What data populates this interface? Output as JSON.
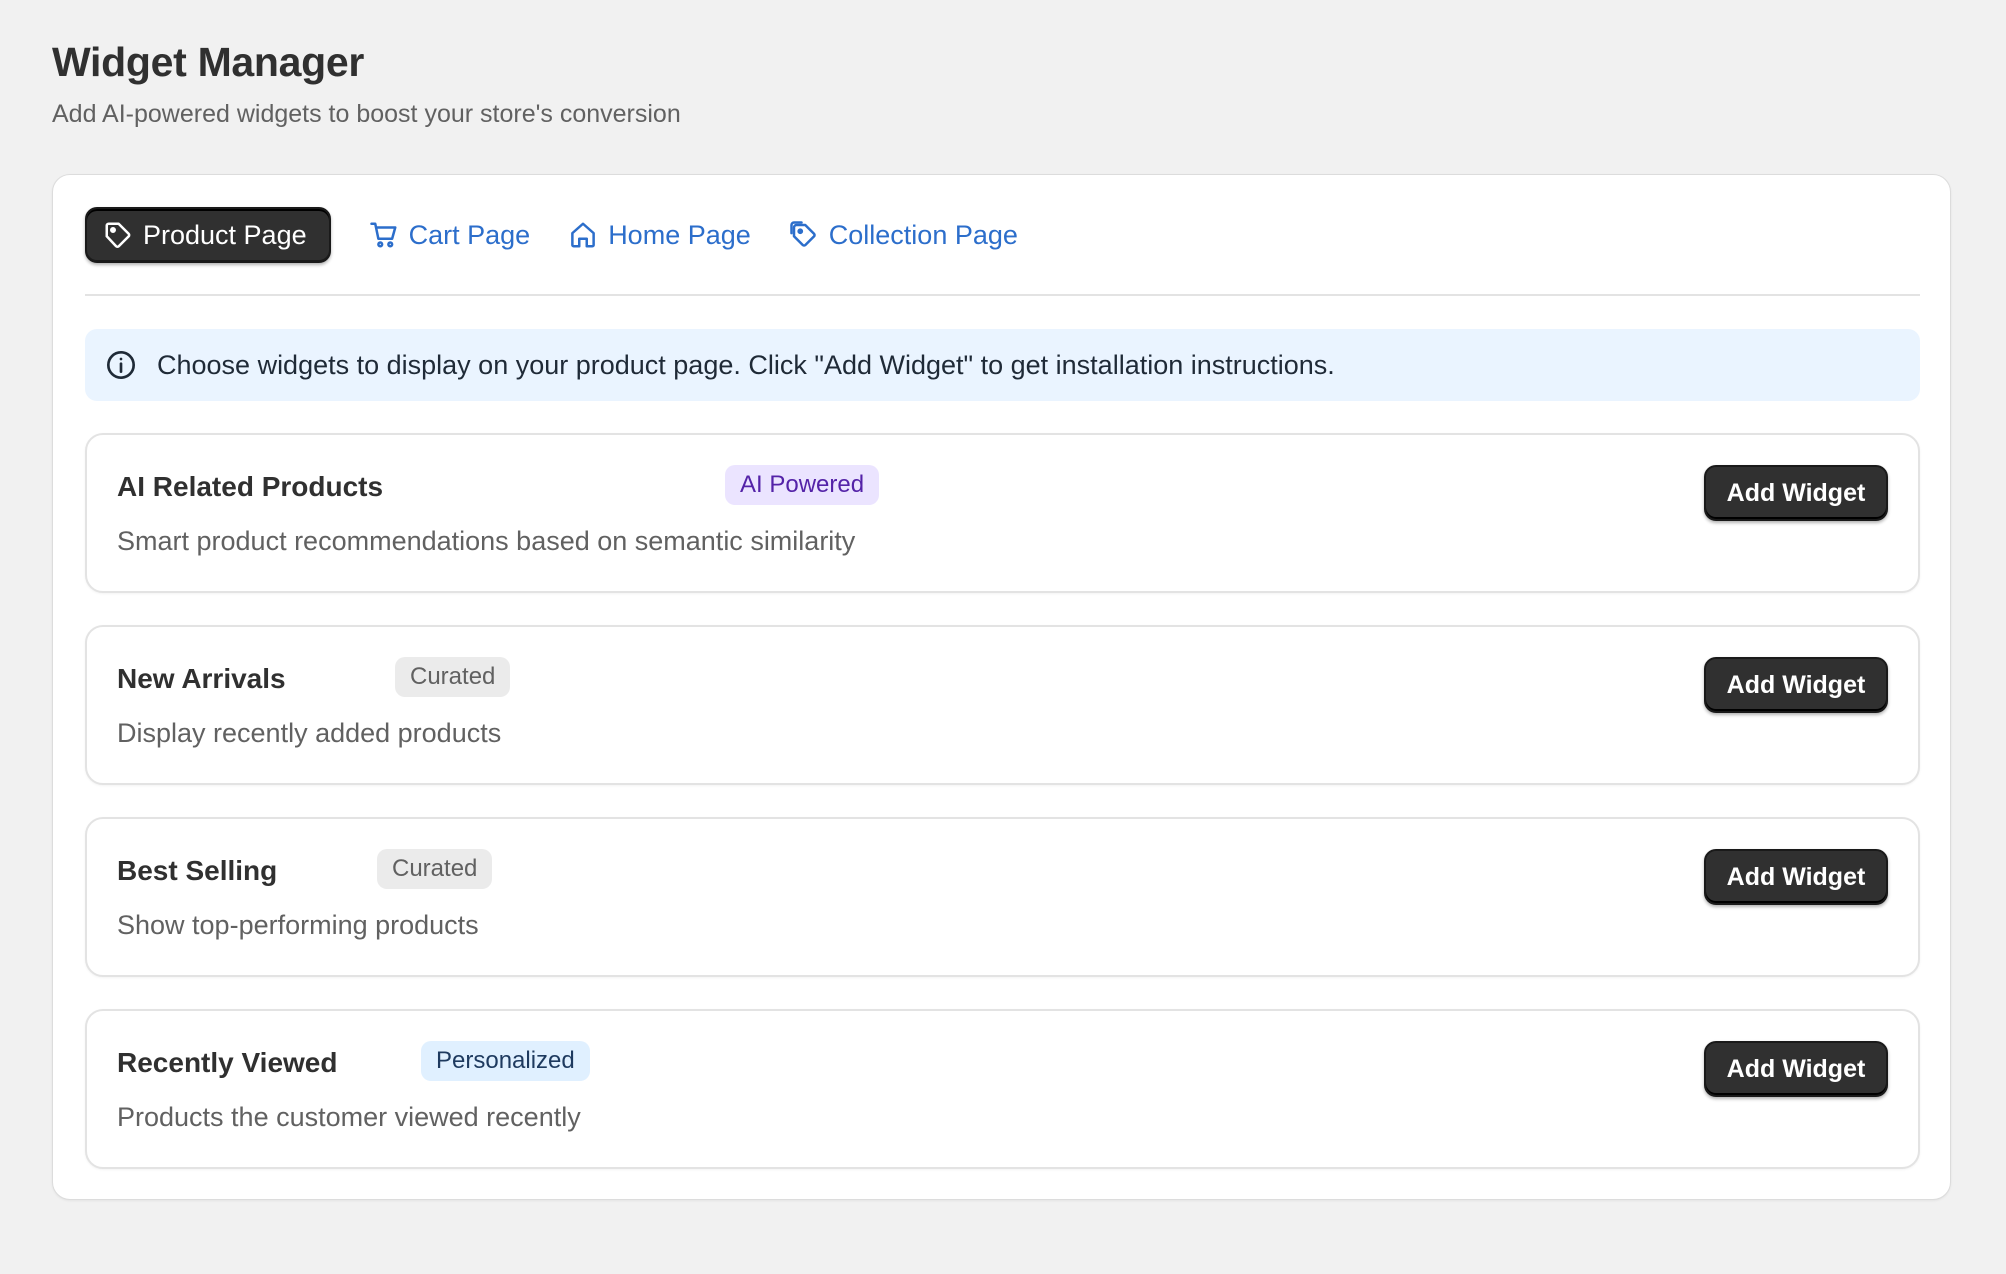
{
  "header": {
    "title": "Widget Manager",
    "subtitle": "Add AI-powered widgets to boost your store's conversion"
  },
  "tabs": [
    {
      "label": "Product Page",
      "icon": "tag-icon",
      "active": true
    },
    {
      "label": "Cart Page",
      "icon": "cart-icon",
      "active": false
    },
    {
      "label": "Home Page",
      "icon": "home-icon",
      "active": false
    },
    {
      "label": "Collection Page",
      "icon": "collection-tag-icon",
      "active": false
    }
  ],
  "banner": {
    "icon": "info-icon",
    "text": "Choose widgets to display on your product page. Click \"Add Widget\" to get installation instructions."
  },
  "widgets": [
    {
      "title": "AI Related Products",
      "badge": "AI Powered",
      "badge_type": "ai",
      "description": "Smart product recommendations based on semantic similarity",
      "button": "Add Widget"
    },
    {
      "title": "New Arrivals",
      "badge": "Curated",
      "badge_type": "curated",
      "description": "Display recently added products",
      "button": "Add Widget"
    },
    {
      "title": "Best Selling",
      "badge": "Curated",
      "badge_type": "curated",
      "description": "Show top-performing products",
      "button": "Add Widget"
    },
    {
      "title": "Recently Viewed",
      "badge": "Personalized",
      "badge_type": "personalized",
      "description": "Products the customer viewed recently",
      "button": "Add Widget"
    }
  ],
  "colors": {
    "accent_link": "#2c6ecb",
    "button_dark": "#303030",
    "banner_bg": "#eaf4ff",
    "badge_ai_bg": "#ebe4ff",
    "badge_curated_bg": "#ebebeb",
    "badge_personalized_bg": "#e0f0ff"
  }
}
